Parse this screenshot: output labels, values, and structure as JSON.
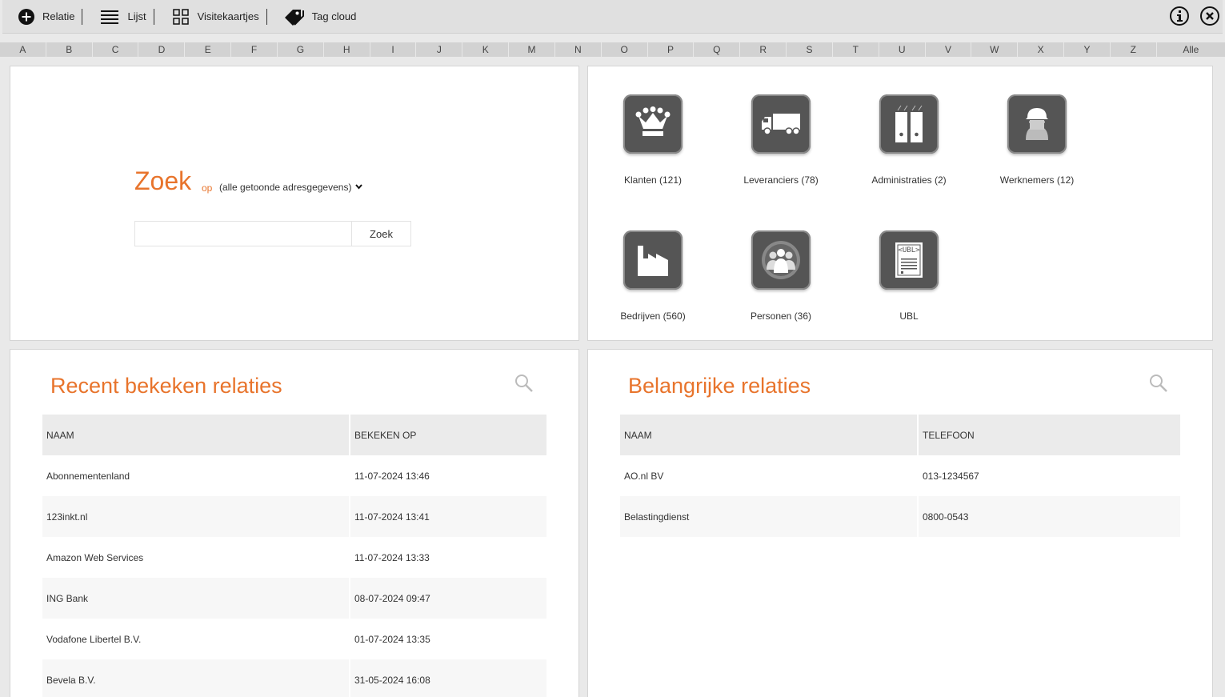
{
  "toolbar": {
    "relatie": "Relatie",
    "lijst": "Lijst",
    "visitekaartjes": "Visitekaartjes",
    "tagcloud": "Tag cloud"
  },
  "alphabet": [
    "A",
    "B",
    "C",
    "D",
    "E",
    "F",
    "G",
    "H",
    "I",
    "J",
    "K",
    "M",
    "N",
    "O",
    "P",
    "Q",
    "R",
    "S",
    "T",
    "U",
    "V",
    "W",
    "X",
    "Y",
    "Z",
    "Alle"
  ],
  "search": {
    "title": "Zoek",
    "op": "op",
    "scope": "(alle getoonde adresgegevens)",
    "input_value": "",
    "button": "Zoek"
  },
  "tiles": [
    {
      "label": "Klanten (121)",
      "icon": "crown-icon"
    },
    {
      "label": "Leveranciers (78)",
      "icon": "truck-icon"
    },
    {
      "label": "Administraties (2)",
      "icon": "binders-icon"
    },
    {
      "label": "Werknemers (12)",
      "icon": "worker-icon"
    },
    {
      "label": "Bedrijven (560)",
      "icon": "factory-icon"
    },
    {
      "label": "Personen (36)",
      "icon": "people-icon"
    },
    {
      "label": "UBL",
      "icon": "ubl-icon"
    }
  ],
  "recent": {
    "title": "Recent bekeken relaties",
    "col_name": "NAAM",
    "col_date": "BEKEKEN OP",
    "rows": [
      {
        "name": "Abonnementenland",
        "date": "11-07-2024 13:46"
      },
      {
        "name": "123inkt.nl",
        "date": "11-07-2024 13:41"
      },
      {
        "name": "Amazon Web Services",
        "date": "11-07-2024 13:33"
      },
      {
        "name": "ING Bank",
        "date": "08-07-2024 09:47"
      },
      {
        "name": "Vodafone Libertel B.V.",
        "date": "01-07-2024 13:35"
      },
      {
        "name": "Bevela B.V.",
        "date": "31-05-2024 16:08"
      }
    ]
  },
  "important": {
    "title": "Belangrijke relaties",
    "col_name": "NAAM",
    "col_phone": "TELEFOON",
    "rows": [
      {
        "name": "AO.nl BV",
        "phone": "013-1234567"
      },
      {
        "name": "Belastingdienst",
        "phone": "0800-0543"
      }
    ]
  },
  "colors": {
    "accent": "#e8742c",
    "tile": "#555555"
  }
}
